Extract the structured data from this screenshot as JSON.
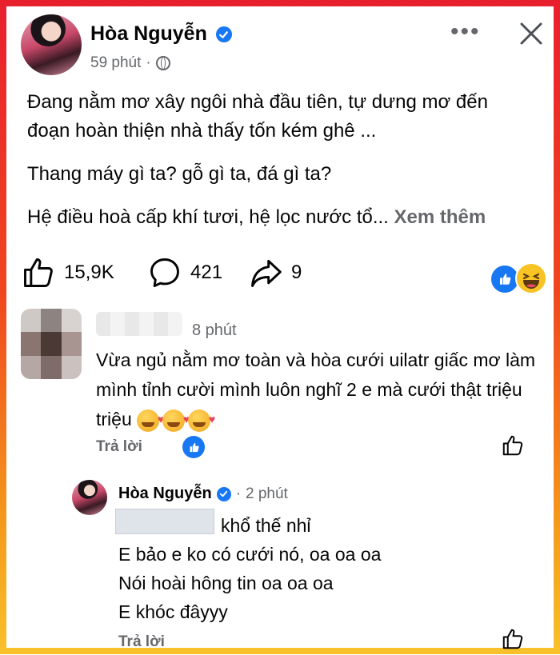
{
  "post": {
    "author": "Hòa Nguyễn",
    "time": "59 phút",
    "separator": "·",
    "more_label": "•••",
    "text_lines": [
      "Đang nằm mơ xây ngôi nhà đầu tiên, tự dưng mơ đến",
      "đoạn hoàn thiện nhà thấy tốn kém ghê ...",
      "Thang máy gì ta? gỗ gì ta, đá gì ta?",
      "Hệ điều hoà cấp khí tươi, hệ lọc nước tổ..."
    ],
    "see_more": "Xem thêm",
    "likes": "15,9K",
    "comments": "421",
    "shares": "9",
    "reactions": [
      "like-icon",
      "haha-icon"
    ]
  },
  "comment1": {
    "time": "8 phút",
    "text": "Vừa ngủ nằm mơ toàn và hòa cưới uilatr giấc mơ làm mình tỉnh cười mình luôn nghĩ 2 e mà cưới thật triệu triệu",
    "emoji_count": 3,
    "reply_label": "Trả lời"
  },
  "reply": {
    "author": "Hòa Nguyễn",
    "separator": "·",
    "time": "2 phút",
    "mention_suffix": "khổ thế nhỉ",
    "lines": [
      "E bảo e ko có cưới nó, oa oa oa",
      "Nói hoài hông tin oa oa oa",
      "E khóc đâyyy"
    ],
    "reply_label": "Trả lời"
  },
  "colors": {
    "brand_blue": "#1877f2",
    "secondary_text": "#65676b",
    "border_top": "#e8202e",
    "border_bottom": "#f8c12a"
  }
}
